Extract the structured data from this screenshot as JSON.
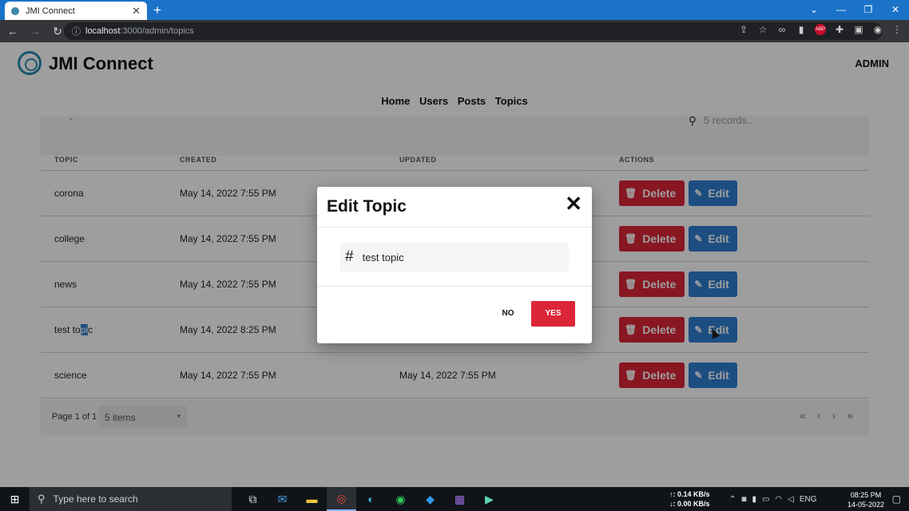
{
  "browser": {
    "tab_title": "JMI Connect",
    "tab_close": "✕",
    "new_tab": "+",
    "url_host": "localhost",
    "url_path": ":3000/admin/topics",
    "win_min": "—",
    "win_restore": "❐",
    "win_close": "✕"
  },
  "app": {
    "brand": "JMI Connect",
    "admin_label": "ADMIN",
    "nav": [
      "Home",
      "Users",
      "Posts",
      "Topics"
    ],
    "search_placeholder": "5 records..."
  },
  "table": {
    "headers": [
      "TOPIC",
      "CREATED",
      "UPDATED",
      "ACTIONS"
    ],
    "rows": [
      {
        "topic": "corona",
        "created": "May 14, 2022 7:55 PM",
        "updated": ""
      },
      {
        "topic": "college",
        "created": "May 14, 2022 7:55 PM",
        "updated": ""
      },
      {
        "topic": "news",
        "created": "May 14, 2022 7:55 PM",
        "updated": ""
      },
      {
        "topic_pre": "test to",
        "topic_hl": "pi",
        "topic_post": "c",
        "created": "May 14, 2022 8:25 PM",
        "updated": ""
      },
      {
        "topic": "science",
        "created": "May 14, 2022 7:55 PM",
        "updated": "May 14, 2022 7:55 PM"
      }
    ],
    "delete_label": "Delete",
    "edit_label": "Edit"
  },
  "pager": {
    "page_info": "Page 1 of 1",
    "items_select": "5 items",
    "first": "«",
    "prev": "‹",
    "next": "›",
    "last": "»"
  },
  "modal": {
    "title": "Edit Topic",
    "close": "✕",
    "hash": "#",
    "input_value": "test topic",
    "no_label": "NO",
    "yes_label": "YES"
  },
  "taskbar": {
    "search_placeholder": "Type here to search",
    "net_up": "↑: 0.14 KB/s",
    "net_down": "↓: 0.00 KB/s",
    "lang": "ENG",
    "time": "08:25 PM",
    "date": "14-05-2022"
  }
}
